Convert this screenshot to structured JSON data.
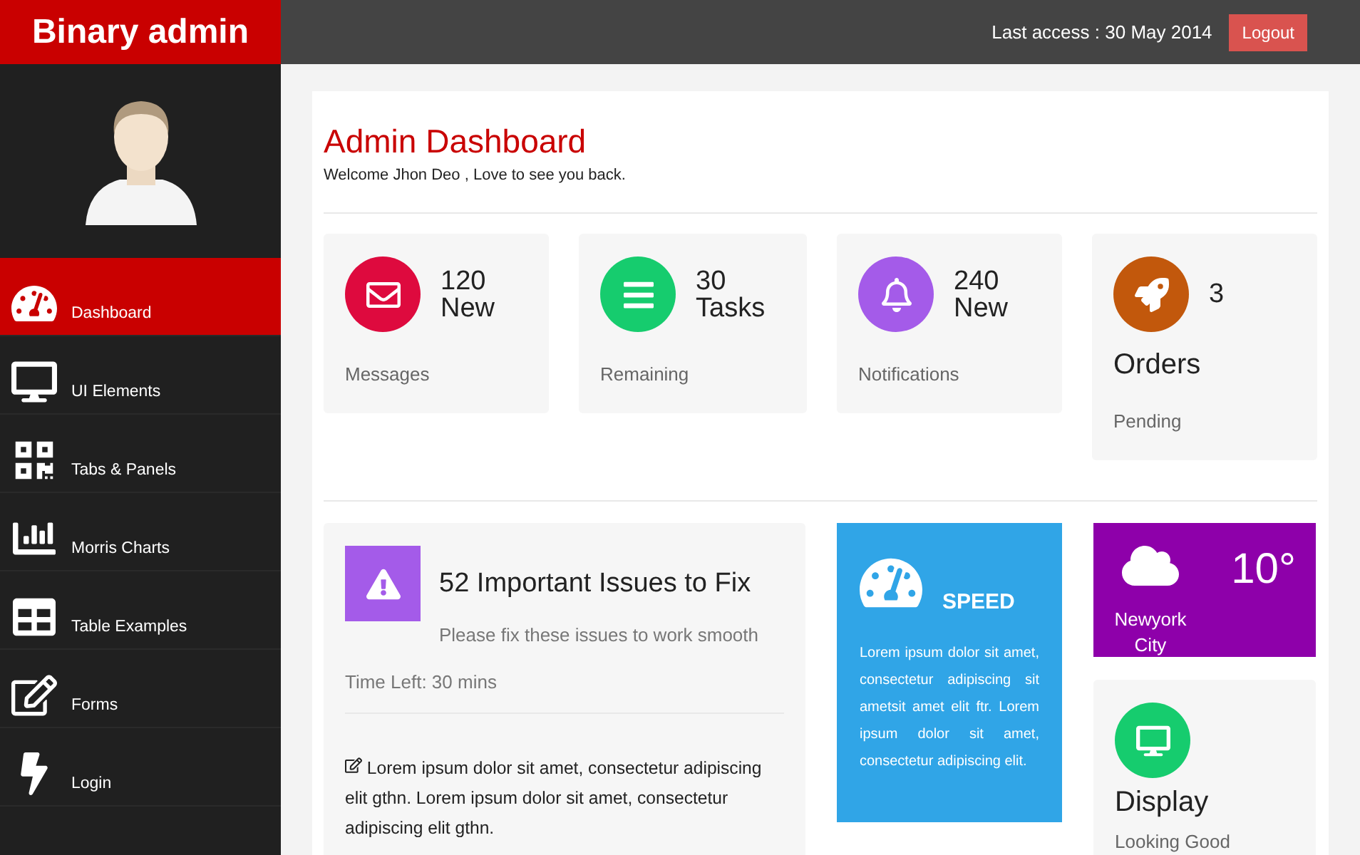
{
  "brand": "Binary admin",
  "topbar": {
    "last_access": "Last access : 30 May 2014",
    "logout": "Logout"
  },
  "sidebar": {
    "items": [
      {
        "kind": "dashboard",
        "label": "Dashboard",
        "selected": true
      },
      {
        "kind": "monitor",
        "label": "UI Elements",
        "selected": false
      },
      {
        "kind": "qrcode",
        "label": "Tabs & Panels",
        "selected": false
      },
      {
        "kind": "chart",
        "label": "Morris Charts",
        "selected": false
      },
      {
        "kind": "table",
        "label": "Table Examples",
        "selected": false
      },
      {
        "kind": "edit",
        "label": "Forms",
        "selected": false
      },
      {
        "kind": "bolt",
        "label": "Login",
        "selected": false
      }
    ]
  },
  "page": {
    "title": "Admin Dashboard",
    "subtitle": "Welcome Jhon Deo , Love to see you back."
  },
  "stats": [
    {
      "kind": "envelope",
      "color": "#de0a3e",
      "value": "120",
      "unit": "New",
      "caption": "Messages",
      "wrapped": false
    },
    {
      "kind": "bars",
      "color": "#16cc6e",
      "value": "30",
      "unit": "Tasks",
      "caption": "Remaining",
      "wrapped": false
    },
    {
      "kind": "bell",
      "color": "#a45be9",
      "value": "240",
      "unit": "New",
      "caption": "Notifications",
      "wrapped": false
    },
    {
      "kind": "rocket",
      "color": "#c2580c",
      "value": "3",
      "unit": "Orders",
      "caption": "Pending",
      "wrapped": true
    }
  ],
  "issues": {
    "title": "52 Important Issues to Fix",
    "subtitle": "Please fix these issues to work smooth",
    "time_left": "Time Left: 30 mins",
    "text": "Lorem ipsum dolor sit amet, consectetur adipiscing elit gthn. Lorem ipsum dolor sit amet, consectetur adipiscing elit gthn."
  },
  "speed": {
    "title": "SPEED",
    "text": "Lorem ipsum dolor sit amet, consectetur adipiscing sit ametsit amet elit ftr. Lorem ipsum dolor sit amet, consectetur adipiscing elit."
  },
  "weather": {
    "city": "Newyork City",
    "temperature": "10°"
  },
  "display": {
    "title": "Display",
    "caption": "Looking Good"
  }
}
